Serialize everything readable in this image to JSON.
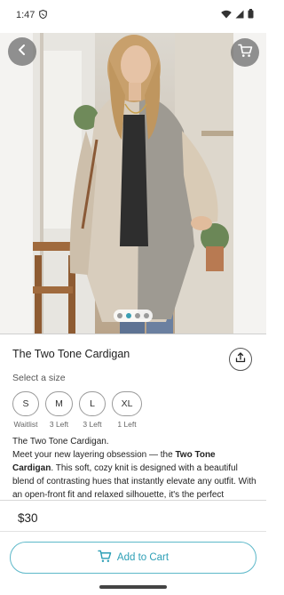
{
  "status_bar": {
    "time": "1:47",
    "icons": [
      "shield-status-icon",
      "wifi-icon",
      "signal-icon",
      "battery-icon"
    ]
  },
  "hero": {
    "image_count": 4,
    "active_index": 1,
    "icons": {
      "back": "arrow-left-icon",
      "cart": "cart-icon"
    }
  },
  "product": {
    "title": "The Two Tone Cardigan",
    "share_icon": "share-icon"
  },
  "sizes": {
    "label": "Select a size",
    "options": [
      {
        "size": "S",
        "availability": "Waitlist"
      },
      {
        "size": "M",
        "availability": "3 Left"
      },
      {
        "size": "L",
        "availability": "3 Left"
      },
      {
        "size": "XL",
        "availability": "1 Left"
      }
    ]
  },
  "description": {
    "heading": "The Two Tone Cardigan.",
    "line_prefix": "Meet your new layering obsession — the ",
    "bold": "Two Tone Cardigan",
    "line_suffix": ". This soft, cozy knit is designed with a beautiful blend of contrasting hues that instantly elevate any outfit. With an open-front fit and relaxed silhouette, it's the perfect"
  },
  "footer": {
    "price": "$30",
    "add_to_cart_label": "Add to Cart"
  },
  "colors": {
    "accent": "#2d9fb6",
    "accent_border": "#5db8c9",
    "overlay_button": "#6e6e6e"
  }
}
